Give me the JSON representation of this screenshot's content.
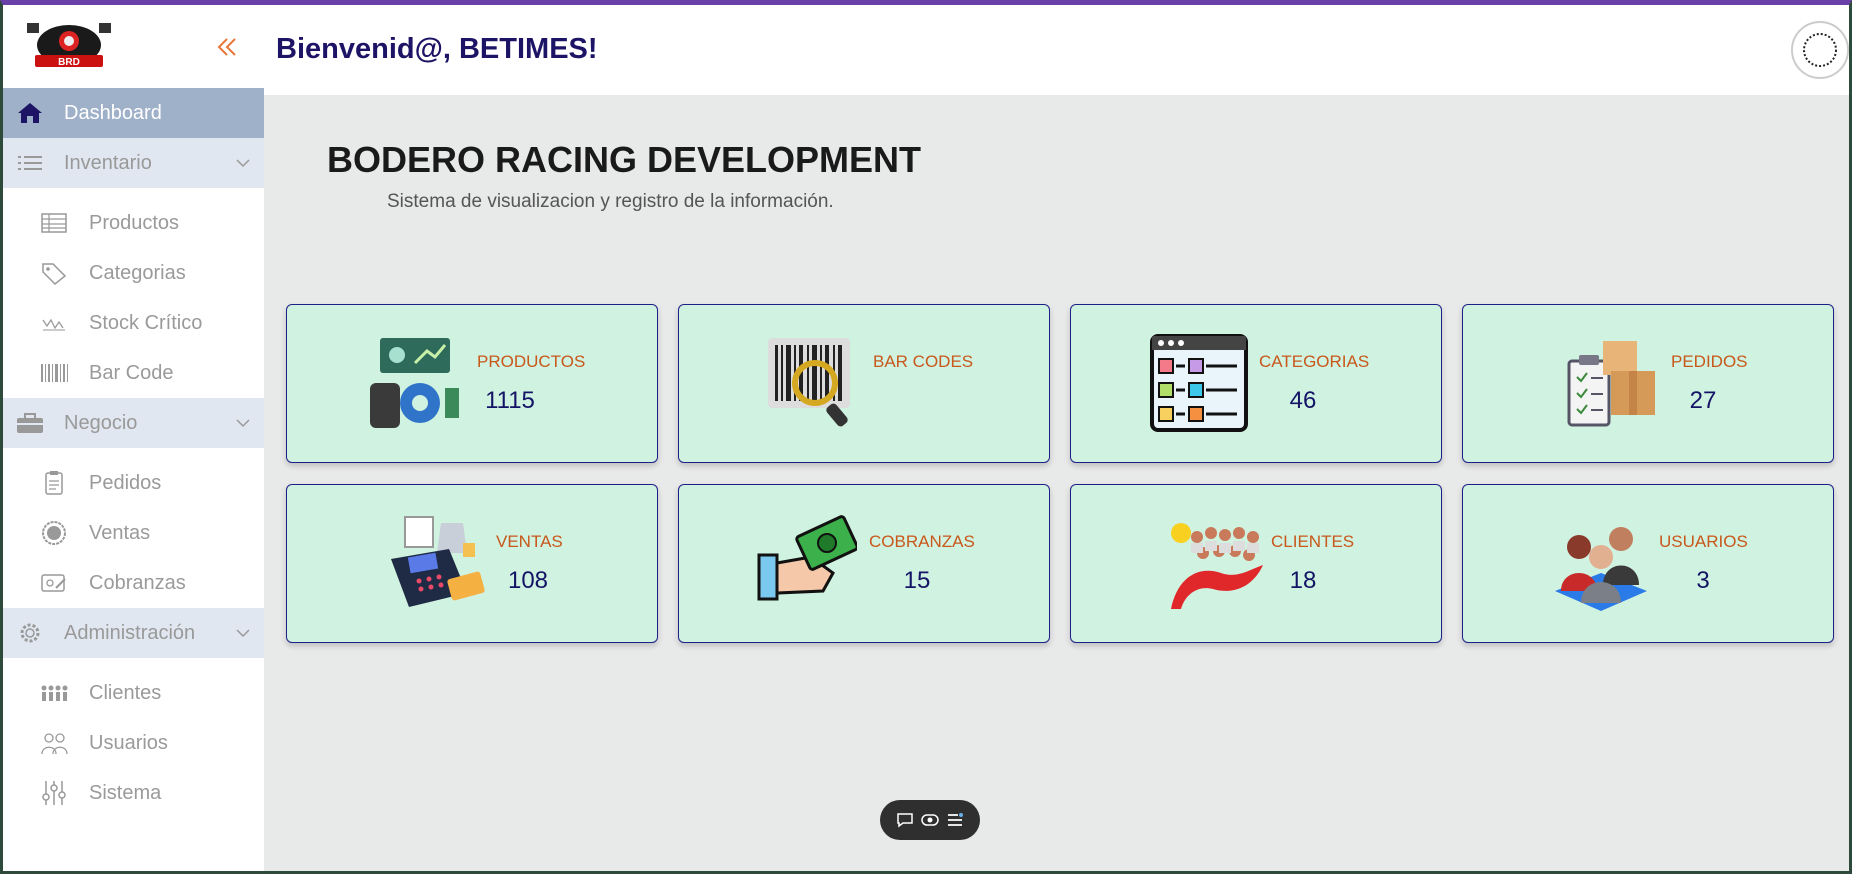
{
  "header": {
    "welcome": "Bienvenid@, BETIMES!"
  },
  "logo": {
    "text": "BRD"
  },
  "sidebar": {
    "dashboard": "Dashboard",
    "inventario": "Inventario",
    "productos": "Productos",
    "categorias": "Categorias",
    "stock": "Stock Crítico",
    "barcode": "Bar Code",
    "negocio": "Negocio",
    "pedidos": "Pedidos",
    "ventas": "Ventas",
    "cobranzas": "Cobranzas",
    "administracion": "Administración",
    "clientes": "Clientes",
    "usuarios": "Usuarios",
    "sistema": "Sistema"
  },
  "main": {
    "title": "BODERO RACING DEVELOPMENT",
    "subtitle": "Sistema de visualizacion y registro de la información.",
    "cards": [
      {
        "title": "PRODUCTOS",
        "value": "1115"
      },
      {
        "title": "BAR CODES",
        "value": ""
      },
      {
        "title": "CATEGORIAS",
        "value": "46"
      },
      {
        "title": "PEDIDOS",
        "value": "27"
      },
      {
        "title": "VENTAS",
        "value": "108"
      },
      {
        "title": "COBRANZAS",
        "value": "15"
      },
      {
        "title": "CLIENTES",
        "value": "18"
      },
      {
        "title": "USUARIOS",
        "value": "3"
      }
    ]
  },
  "colors": {
    "accent": "#6a3fa8",
    "active_nav": "#9fb1c8",
    "section_bg": "#e1e7f0",
    "card_bg": "#d0f2e0",
    "card_title": "#c8581b",
    "card_value": "#141466",
    "welcome": "#1d1466"
  }
}
